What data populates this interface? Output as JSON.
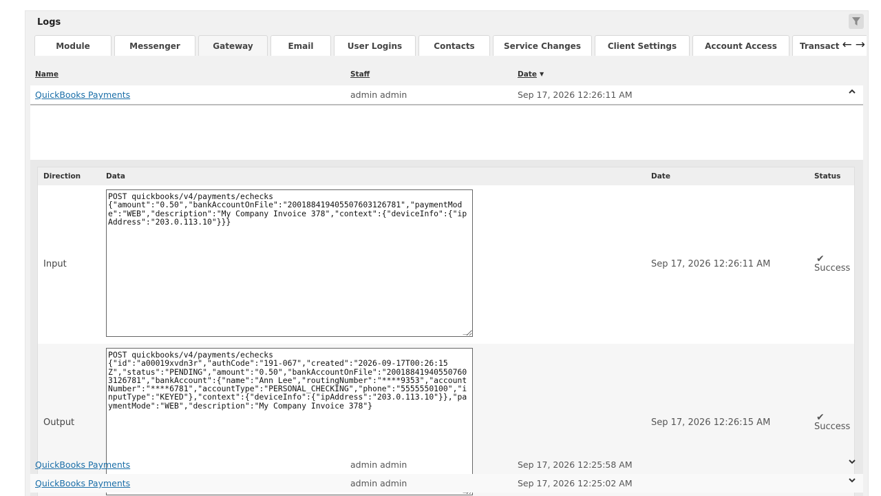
{
  "panel": {
    "title": "Logs",
    "filter_icon": "filter-icon"
  },
  "tabs": [
    {
      "label": "Module"
    },
    {
      "label": "Messenger"
    },
    {
      "label": "Gateway",
      "active": true
    },
    {
      "label": "Email"
    },
    {
      "label": "User Logins"
    },
    {
      "label": "Contacts"
    },
    {
      "label": "Service Changes"
    },
    {
      "label": "Client Settings"
    },
    {
      "label": "Account Access"
    },
    {
      "label": "Transact"
    }
  ],
  "tab_nav": {
    "prev": "←",
    "next": "→"
  },
  "columns": {
    "name": "Name",
    "staff": "Staff",
    "date": "Date",
    "sort_caret": "▼"
  },
  "rows": [
    {
      "name": "QuickBooks Payments",
      "staff": "admin admin",
      "date": "Sep 17, 2026 12:26:11 AM",
      "toggle": "⌃"
    },
    {
      "name": "QuickBooks Payments",
      "staff": "admin admin",
      "date": "Sep 17, 2026 12:25:58 AM",
      "toggle": "⌄"
    },
    {
      "name": "QuickBooks Payments",
      "staff": "admin admin",
      "date": "Sep 17, 2026 12:25:02 AM",
      "toggle": "⌄"
    }
  ],
  "detail": {
    "columns": {
      "direction": "Direction",
      "data": "Data",
      "date": "Date",
      "status": "Status"
    },
    "entries": [
      {
        "direction": "Input",
        "data": "POST quickbooks/v4/payments/echecks\n{\"amount\":\"0.50\",\"bankAccountOnFile\":\"200188419405507603126781\",\"paymentMode\":\"WEB\",\"description\":\"My Company Invoice 378\",\"context\":{\"deviceInfo\":{\"ipAddress\":\"203.0.113.10\"}}}",
        "date": "Sep 17, 2026 12:26:11 AM",
        "status": "Success",
        "status_icon": "✔"
      },
      {
        "direction": "Output",
        "data": "POST quickbooks/v4/payments/echecks\n{\"id\":\"a00019xvdn3r\",\"authCode\":\"191-067\",\"created\":\"2026-09-17T00:26:15Z\",\"status\":\"PENDING\",\"amount\":\"0.50\",\"bankAccountOnFile\":\"200188419405507603126781\",\"bankAccount\":{\"name\":\"Ann Lee\",\"routingNumber\":\"****9353\",\"accountNumber\":\"****6781\",\"accountType\":\"PERSONAL_CHECKING\",\"phone\":\"5555550100\",\"inputType\":\"KEYED\"},\"context\":{\"deviceInfo\":{\"ipAddress\":\"203.0.113.10\"}},\"paymentMode\":\"WEB\",\"description\":\"My Company Invoice 378\"}",
        "date": "Sep 17, 2026 12:26:15 AM",
        "status": "Success",
        "status_icon": "✔"
      }
    ]
  }
}
